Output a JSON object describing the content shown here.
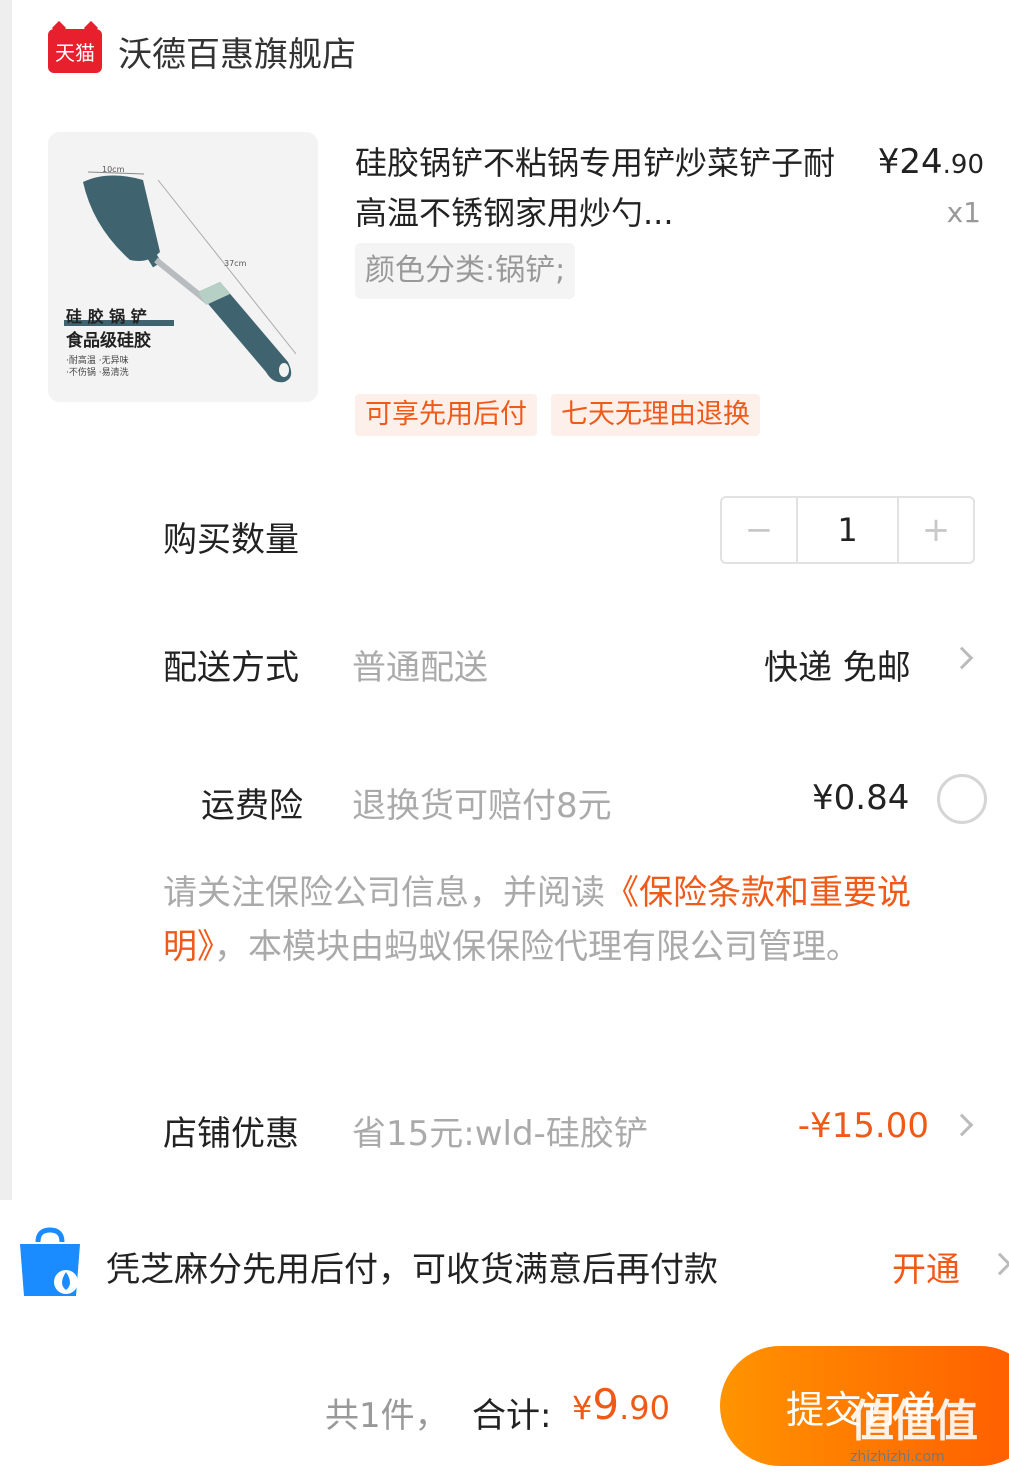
{
  "shop": {
    "name": "沃德百惠旗舰店",
    "logo_text": "天猫"
  },
  "product": {
    "title": "硅胶锅铲不粘锅专用铲炒菜铲子耐高温不锈钢家用炒勺...",
    "price_currency": "¥",
    "price_int": "24",
    "price_dec": ".90",
    "quantity_mark": "x1",
    "sku": "颜色分类:锅铲;",
    "tags": [
      "可享先用后付",
      "七天无理由退换"
    ],
    "image": {
      "dim_width": "10cm",
      "dim_length": "37cm",
      "headline1": "硅 胶 锅 铲",
      "headline2": "食品级硅胶",
      "feature1": "·耐高温 ·无异味",
      "feature2": "·不伤锅 ·易清洗"
    }
  },
  "quantity": {
    "label": "购买数量",
    "value": "1",
    "minus": "−",
    "plus": "+"
  },
  "delivery": {
    "label": "配送方式",
    "desc": "普通配送",
    "value": "快递 免邮"
  },
  "insurance": {
    "label": "运费险",
    "desc": "退换货可赔付8元",
    "price": "¥0.84"
  },
  "notice": {
    "prefix": "请关注保险公司信息，并阅读",
    "link": "《保险条款和重要说明》",
    "suffix": "，本模块由蚂蚁保保险代理有限公司管理。"
  },
  "shop_discount": {
    "label": "店铺优惠",
    "desc": "省15元:wld-硅胶铲",
    "value": "-¥15.00"
  },
  "promo": {
    "text": "凭芝麻分先用后付，可收货满意后再付款",
    "action": "开通"
  },
  "footer": {
    "count": "共1件，",
    "total_label": "合计:",
    "total_currency": "¥",
    "total_int": "9",
    "total_dec": ".90",
    "submit": "提交订单"
  },
  "watermark": {
    "big": "值值值",
    "small": "zhizhizhi.com"
  },
  "colors": {
    "accent": "#f05a18",
    "tmall_red": "#e8202e",
    "button_start": "#ff9400",
    "button_end": "#ff5a00"
  }
}
